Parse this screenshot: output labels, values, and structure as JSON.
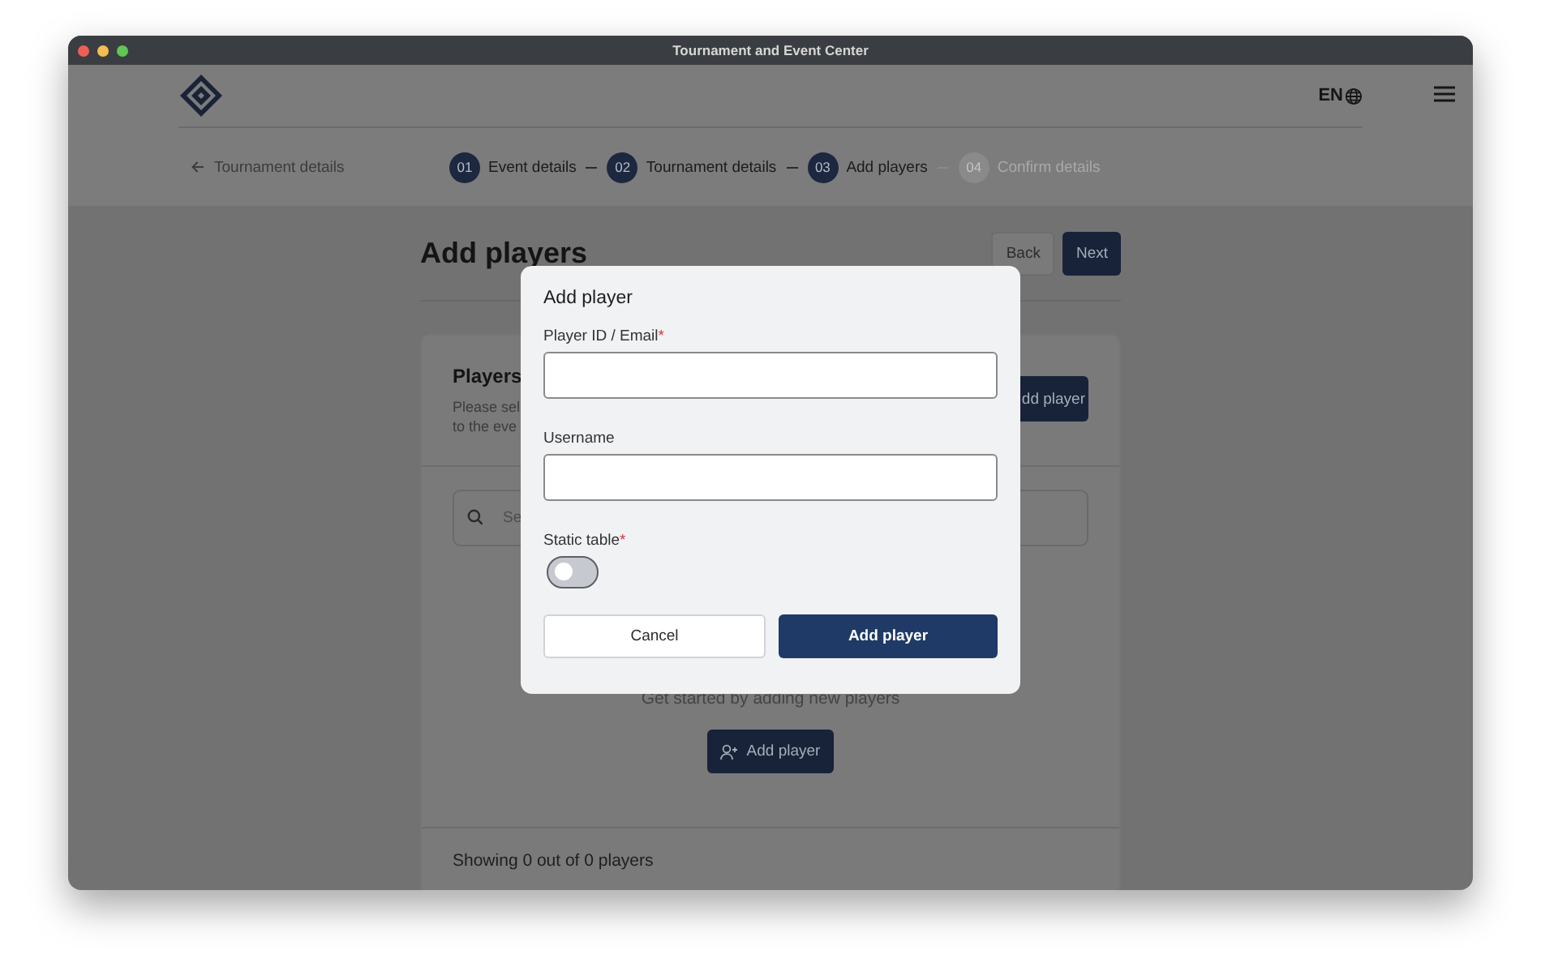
{
  "window": {
    "title": "Tournament and Event Center"
  },
  "header": {
    "language": "EN"
  },
  "breadcrumb": {
    "back_label": "Tournament details"
  },
  "steps": [
    {
      "number": "01",
      "label": "Event details",
      "disabled": false
    },
    {
      "number": "02",
      "label": "Tournament details",
      "disabled": false
    },
    {
      "number": "03",
      "label": "Add players",
      "disabled": false
    },
    {
      "number": "04",
      "label": "Confirm details",
      "disabled": true
    }
  ],
  "page": {
    "title": "Add players",
    "buttons": [
      {
        "label": "Back",
        "kind": "secondary"
      },
      {
        "label": "Next",
        "kind": "primary"
      }
    ]
  },
  "players_card": {
    "title": "Players",
    "description": "Please sel\nto the eve",
    "header_button": "dd player",
    "search": {
      "placeholder": "Se"
    },
    "empty_message": "Get started by adding new players",
    "empty_button": "Add player",
    "footer": "Showing 0 out of 0 players"
  },
  "dialog": {
    "title": "Add player",
    "fields": [
      {
        "kind": "text",
        "label": "Player ID / Email",
        "required_mark": "*"
      },
      {
        "kind": "text",
        "label": "Username"
      },
      {
        "kind": "toggle",
        "label": "Static table",
        "required_mark": "*",
        "on": false
      }
    ],
    "buttons": [
      {
        "label": "Cancel",
        "kind": "secondary"
      },
      {
        "label": "Add player",
        "kind": "primary"
      }
    ]
  }
}
